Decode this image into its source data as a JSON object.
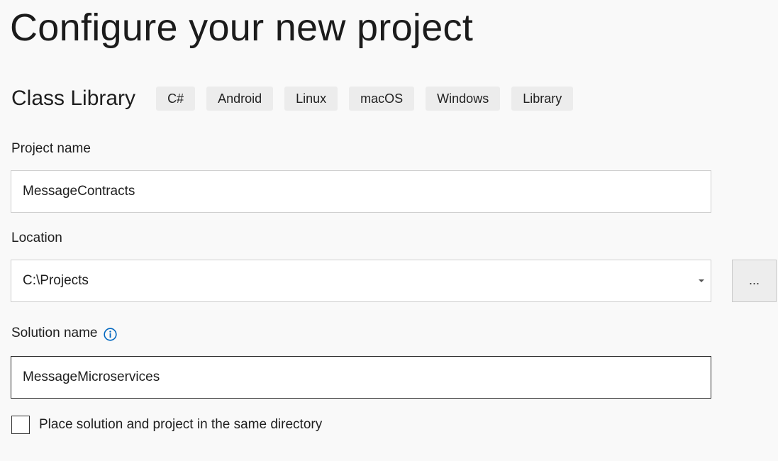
{
  "page": {
    "title": "Configure your new project"
  },
  "template": {
    "name": "Class Library",
    "tags": [
      "C#",
      "Android",
      "Linux",
      "macOS",
      "Windows",
      "Library"
    ]
  },
  "project_name": {
    "label": "Project name",
    "value": "MessageContracts"
  },
  "location": {
    "label": "Location",
    "value": "C:\\Projects",
    "browse_label": "...",
    "dropdown_icon": "chevron-down-icon"
  },
  "solution_name": {
    "label": "Solution name",
    "info_icon": "info-icon",
    "value": "MessageMicroservices"
  },
  "same_directory": {
    "label": "Place solution and project in the same directory",
    "checked": false
  },
  "colors": {
    "background": "#f9f9f9",
    "accent": "#0067c0",
    "tag_background": "#ececec"
  }
}
